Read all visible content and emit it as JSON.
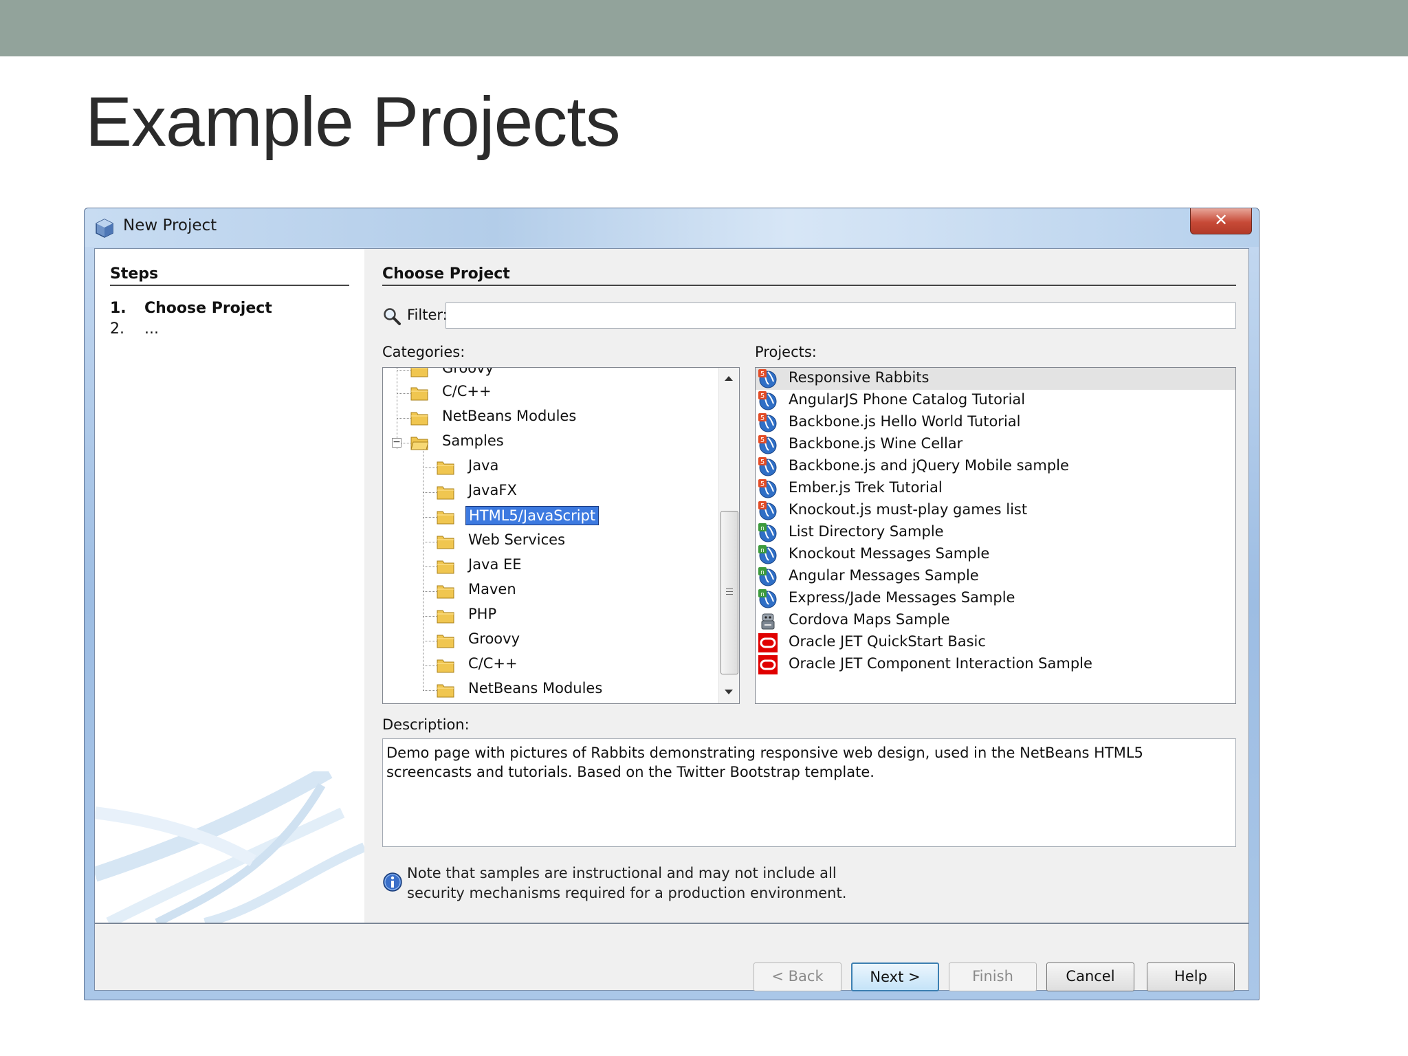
{
  "slide": {
    "title": "Example Projects"
  },
  "window": {
    "title": "New Project",
    "close_glyph": "✕"
  },
  "steps": {
    "heading": "Steps",
    "items": [
      {
        "num": "1.",
        "label": "Choose Project"
      },
      {
        "num": "2.",
        "label": "..."
      }
    ]
  },
  "main": {
    "heading": "Choose Project",
    "filter_label": "Filter:",
    "filter_value": "",
    "categories_label": "Categories:",
    "projects_label": "Projects:",
    "description_label": "Description:"
  },
  "categories": [
    {
      "label": "Groovy",
      "level": 1
    },
    {
      "label": "C/C++",
      "level": 1
    },
    {
      "label": "NetBeans Modules",
      "level": 1
    },
    {
      "label": "Samples",
      "level": 1,
      "expanded": true
    },
    {
      "label": "Java",
      "level": 2
    },
    {
      "label": "JavaFX",
      "level": 2
    },
    {
      "label": "HTML5/JavaScript",
      "level": 2,
      "selected": true
    },
    {
      "label": "Web Services",
      "level": 2
    },
    {
      "label": "Java EE",
      "level": 2
    },
    {
      "label": "Maven",
      "level": 2
    },
    {
      "label": "PHP",
      "level": 2
    },
    {
      "label": "Groovy",
      "level": 2
    },
    {
      "label": "C/C++",
      "level": 2
    },
    {
      "label": "NetBeans Modules",
      "level": 2
    }
  ],
  "projects": [
    {
      "label": "Responsive Rabbits",
      "icon": "html5-globe-icon",
      "highlighted": true
    },
    {
      "label": "AngularJS Phone Catalog Tutorial",
      "icon": "html5-globe-icon"
    },
    {
      "label": "Backbone.js Hello World Tutorial",
      "icon": "html5-globe-icon"
    },
    {
      "label": "Backbone.js Wine Cellar",
      "icon": "html5-globe-icon"
    },
    {
      "label": "Backbone.js and jQuery Mobile sample",
      "icon": "html5-globe-icon"
    },
    {
      "label": "Ember.js Trek Tutorial",
      "icon": "html5-globe-icon"
    },
    {
      "label": "Knockout.js must-play games list",
      "icon": "html5-globe-icon"
    },
    {
      "label": "List Directory Sample",
      "icon": "nodejs-globe-icon"
    },
    {
      "label": "Knockout Messages Sample",
      "icon": "nodejs-globe-icon"
    },
    {
      "label": "Angular Messages Sample",
      "icon": "nodejs-globe-icon"
    },
    {
      "label": "Express/Jade Messages Sample",
      "icon": "nodejs-globe-icon"
    },
    {
      "label": "Cordova Maps Sample",
      "icon": "cordova-robot-icon"
    },
    {
      "label": "Oracle JET QuickStart Basic",
      "icon": "oracle-jet-icon"
    },
    {
      "label": "Oracle JET Component Interaction Sample",
      "icon": "oracle-jet-icon"
    }
  ],
  "description": "Demo page with pictures of Rabbits demonstrating responsive web design, used in the NetBeans HTML5 screencasts and tutorials. Based on the Twitter Bootstrap template.",
  "note": {
    "line1": "Note that samples are instructional and may not include all",
    "line2": "security mechanisms required for a production environment."
  },
  "buttons": {
    "back": "< Back",
    "next": "Next >",
    "finish": "Finish",
    "cancel": "Cancel",
    "help": "Help"
  },
  "colors": {
    "topbar": "#92a39b",
    "selection": "#3d7ae0",
    "html5_badge": "#e34c26",
    "nodejs_badge": "#3c9a3c",
    "oracle_red": "#e00000"
  }
}
